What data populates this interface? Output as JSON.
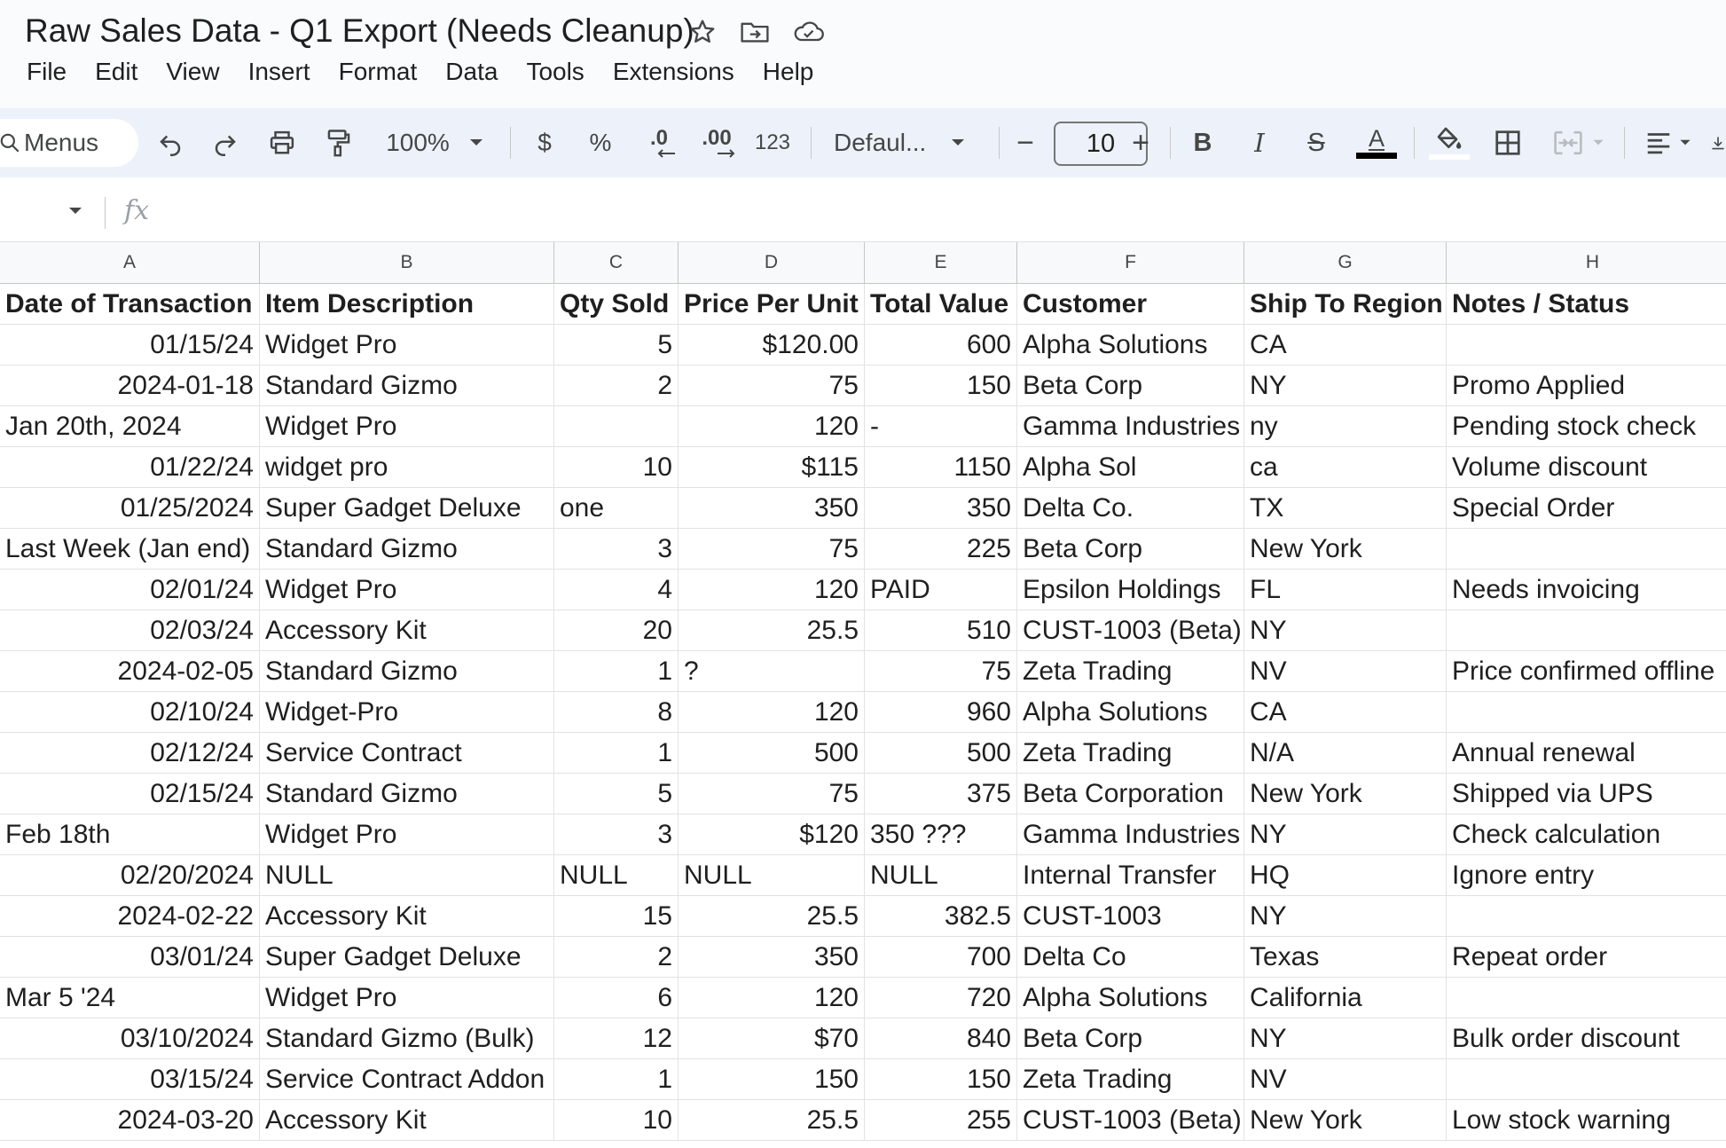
{
  "window": {
    "title": "Raw Sales Data - Q1 Export (Needs Cleanup)",
    "title_icons": [
      "star-icon",
      "move-to-folder-icon",
      "cloud-status-icon"
    ]
  },
  "menubar": [
    "File",
    "Edit",
    "View",
    "Insert",
    "Format",
    "Data",
    "Tools",
    "Extensions",
    "Help"
  ],
  "toolbar": {
    "menus_label": "Menus",
    "zoom": "100%",
    "currency": "$",
    "percent": "%",
    "decrease_decimal": ".0",
    "increase_decimal": ".00",
    "number_format": "123",
    "font": "Defaul...",
    "minus": "−",
    "font_size": "10",
    "plus": "+",
    "bold": "B",
    "italic": "I",
    "strikethrough": "S",
    "text_color": "A",
    "text_color_value": "#000000"
  },
  "formula_bar": {
    "fx": "fx",
    "value": ""
  },
  "columns": [
    "A",
    "B",
    "C",
    "D",
    "E",
    "F",
    "G",
    "H"
  ],
  "header_row": [
    "Date of Transaction",
    "Item Description",
    "Qty Sold",
    "Price Per Unit",
    "Total Value",
    "Customer",
    "Ship To Region",
    "Notes / Status"
  ],
  "rows": [
    [
      "01/15/24",
      "Widget Pro",
      "5",
      "$120.00",
      "600",
      "Alpha Solutions",
      "CA",
      ""
    ],
    [
      "2024-01-18",
      "Standard Gizmo",
      "2",
      "75",
      "150",
      "Beta Corp",
      "NY",
      "Promo Applied"
    ],
    [
      "Jan 20th, 2024",
      "Widget Pro",
      "",
      "120",
      "-",
      "Gamma Industries",
      "ny",
      "Pending stock check"
    ],
    [
      "01/22/24",
      "widget pro",
      "10",
      "$115",
      "1150",
      "Alpha Sol",
      "ca",
      "Volume discount"
    ],
    [
      "01/25/2024",
      "Super Gadget Deluxe",
      "one",
      "350",
      "350",
      "Delta Co.",
      "TX",
      "Special Order"
    ],
    [
      "Last Week (Jan end)",
      "Standard Gizmo",
      "3",
      "75",
      "225",
      "Beta Corp",
      "New York",
      ""
    ],
    [
      "02/01/24",
      "Widget Pro",
      "4",
      "120",
      "PAID",
      "Epsilon Holdings",
      "FL",
      "Needs invoicing"
    ],
    [
      "02/03/24",
      "Accessory Kit",
      "20",
      "25.5",
      "510",
      "CUST-1003 (Beta)",
      "NY",
      ""
    ],
    [
      "2024-02-05",
      "Standard Gizmo",
      "1",
      "?",
      "75",
      "Zeta Trading",
      "NV",
      "Price confirmed offline"
    ],
    [
      "02/10/24",
      "Widget-Pro",
      "8",
      "120",
      "960",
      "Alpha Solutions",
      "CA",
      ""
    ],
    [
      "02/12/24",
      "Service Contract",
      "1",
      "500",
      "500",
      "Zeta Trading",
      "N/A",
      "Annual renewal"
    ],
    [
      "02/15/24",
      "Standard Gizmo",
      "5",
      "75",
      "375",
      "Beta Corporation",
      "New York",
      "Shipped via UPS"
    ],
    [
      "Feb 18th",
      "Widget Pro",
      "3",
      "$120",
      "350 ???",
      "Gamma Industries",
      "NY",
      "Check calculation"
    ],
    [
      "02/20/2024",
      "NULL",
      "NULL",
      "NULL",
      "NULL",
      "Internal Transfer",
      "HQ",
      "Ignore entry"
    ],
    [
      "2024-02-22",
      "Accessory Kit",
      "15",
      "25.5",
      "382.5",
      "CUST-1003",
      "NY",
      ""
    ],
    [
      "03/01/24",
      "Super Gadget Deluxe",
      "2",
      "350",
      "700",
      "Delta Co",
      "Texas",
      "Repeat order"
    ],
    [
      "Mar 5 '24",
      "Widget Pro",
      "6",
      "120",
      "720",
      "Alpha Solutions",
      "California",
      ""
    ],
    [
      "03/10/2024",
      "Standard Gizmo (Bulk)",
      "12",
      "$70",
      "840",
      "Beta Corp",
      "NY",
      "Bulk order discount"
    ],
    [
      "03/15/24",
      "Service Contract Addon",
      "1",
      "150",
      "150",
      "Zeta Trading",
      "NV",
      ""
    ],
    [
      "2024-03-20",
      "Accessory Kit",
      "10",
      "25.5",
      "255",
      "CUST-1003 (Beta)",
      "New York",
      "Low stock warning"
    ]
  ],
  "alignments": [
    [
      "r",
      "l",
      "r",
      "r",
      "r",
      "l",
      "l",
      "l"
    ],
    [
      "r",
      "l",
      "r",
      "r",
      "r",
      "l",
      "l",
      "l"
    ],
    [
      "l",
      "l",
      "r",
      "r",
      "l",
      "l",
      "l",
      "l"
    ],
    [
      "r",
      "l",
      "r",
      "r",
      "r",
      "l",
      "l",
      "l"
    ],
    [
      "r",
      "l",
      "l",
      "r",
      "r",
      "l",
      "l",
      "l"
    ],
    [
      "l",
      "l",
      "r",
      "r",
      "r",
      "l",
      "l",
      "l"
    ],
    [
      "r",
      "l",
      "r",
      "r",
      "l",
      "l",
      "l",
      "l"
    ],
    [
      "r",
      "l",
      "r",
      "r",
      "r",
      "l",
      "l",
      "l"
    ],
    [
      "r",
      "l",
      "r",
      "l",
      "r",
      "l",
      "l",
      "l"
    ],
    [
      "r",
      "l",
      "r",
      "r",
      "r",
      "l",
      "l",
      "l"
    ],
    [
      "r",
      "l",
      "r",
      "r",
      "r",
      "l",
      "l",
      "l"
    ],
    [
      "r",
      "l",
      "r",
      "r",
      "r",
      "l",
      "l",
      "l"
    ],
    [
      "l",
      "l",
      "r",
      "r",
      "l",
      "l",
      "l",
      "l"
    ],
    [
      "r",
      "l",
      "l",
      "l",
      "l",
      "l",
      "l",
      "l"
    ],
    [
      "r",
      "l",
      "r",
      "r",
      "r",
      "l",
      "l",
      "l"
    ],
    [
      "r",
      "l",
      "r",
      "r",
      "r",
      "l",
      "l",
      "l"
    ],
    [
      "l",
      "l",
      "r",
      "r",
      "r",
      "l",
      "l",
      "l"
    ],
    [
      "r",
      "l",
      "r",
      "r",
      "r",
      "l",
      "l",
      "l"
    ],
    [
      "r",
      "l",
      "r",
      "r",
      "r",
      "l",
      "l",
      "l"
    ],
    [
      "r",
      "l",
      "r",
      "r",
      "r",
      "l",
      "l",
      "l"
    ]
  ]
}
